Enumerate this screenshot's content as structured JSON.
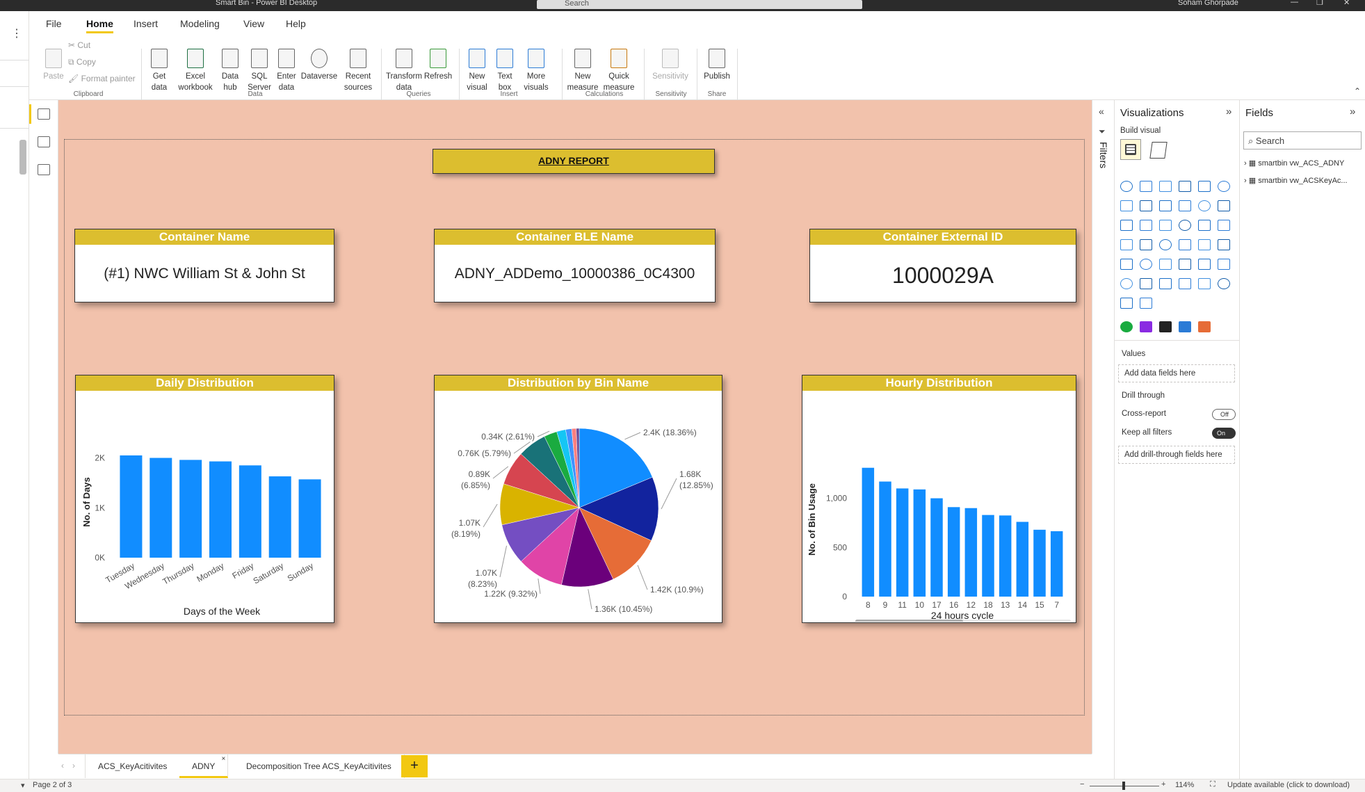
{
  "window": {
    "title": "Smart Bin - Power BI Desktop",
    "search_placeholder": "Search",
    "user": "Soham Ghorpade"
  },
  "ribbon": {
    "tabs": [
      "File",
      "Home",
      "Insert",
      "Modeling",
      "View",
      "Help"
    ],
    "clipboard": {
      "paste": "Paste",
      "cut": "Cut",
      "copy": "Copy",
      "format_painter": "Format painter",
      "group": "Clipboard"
    },
    "data": {
      "get_data": "Get data",
      "excel": "Excel workbook",
      "data_hub": "Data hub",
      "sql": "SQL Server",
      "enter": "Enter data",
      "dataverse": "Dataverse",
      "recent": "Recent sources",
      "group": "Data"
    },
    "queries": {
      "transform": "Transform data",
      "refresh": "Refresh",
      "group": "Queries"
    },
    "insert": {
      "new_visual": "New visual",
      "text_box": "Text box",
      "more_visuals": "More visuals",
      "group": "Insert"
    },
    "calculations": {
      "new_measure": "New measure",
      "quick_measure": "Quick measure",
      "group": "Calculations"
    },
    "sensitivity": {
      "label": "Sensitivity",
      "group": "Sensitivity"
    },
    "share": {
      "publish": "Publish",
      "group": "Share"
    }
  },
  "report": {
    "title": "ADNY REPORT",
    "cards": [
      {
        "header": "Container Name",
        "value": "(#1) NWC William St & John St"
      },
      {
        "header": "Container BLE Name",
        "value": "ADNY_ADDemo_10000386_0C4300"
      },
      {
        "header": "Container External ID",
        "value": "1000029A"
      }
    ]
  },
  "chart_data": [
    {
      "type": "bar",
      "title": "Daily Distribution",
      "xlabel": "Days of the Week",
      "ylabel": "No. of Days",
      "categories": [
        "Tuesday",
        "Wednesday",
        "Thursday",
        "Monday",
        "Friday",
        "Saturday",
        "Sunday"
      ],
      "values": [
        2050,
        2000,
        1960,
        1930,
        1850,
        1630,
        1570
      ],
      "ylim": [
        0,
        2300
      ],
      "yticks": [
        "0K",
        "1K",
        "2K"
      ],
      "color": "#118dff"
    },
    {
      "type": "pie",
      "title": "Distribution by Bin Name",
      "slices": [
        {
          "label": "2.4K (18.36%)",
          "value": 18.36,
          "color": "#118dff"
        },
        {
          "label": "1.68K (12.85%)",
          "value": 12.85,
          "color": "#12239e"
        },
        {
          "label": "1.42K (10.9%)",
          "value": 10.9,
          "color": "#e66c37"
        },
        {
          "label": "1.36K (10.45%)",
          "value": 10.45,
          "color": "#6b007b"
        },
        {
          "label": "1.22K (9.32%)",
          "value": 9.32,
          "color": "#e044a7"
        },
        {
          "label": "1.07K (8.23%)",
          "value": 8.23,
          "color": "#744ec2"
        },
        {
          "label": "1.07K (8.19%)",
          "value": 8.19,
          "color": "#d9b300"
        },
        {
          "label": "0.89K (6.85%)",
          "value": 6.85,
          "color": "#d64550"
        },
        {
          "label": "0.76K (5.79%)",
          "value": 5.79,
          "color": "#197278"
        },
        {
          "label": "0.34K (2.61%)",
          "value": 2.61,
          "color": "#1aab40"
        },
        {
          "label": "",
          "value": 1.8,
          "color": "#15c6f4"
        },
        {
          "label": "",
          "value": 1.2,
          "color": "#4092ff"
        },
        {
          "label": "",
          "value": 0.9,
          "color": "#ff7f7f"
        },
        {
          "label": "",
          "value": 0.6,
          "color": "#6b4c9a"
        }
      ]
    },
    {
      "type": "bar",
      "title": "Hourly Distribution",
      "xlabel": "24 hours cycle",
      "ylabel": "No. of Bin Usage",
      "categories": [
        "8",
        "9",
        "11",
        "10",
        "17",
        "16",
        "12",
        "18",
        "13",
        "14",
        "15",
        "7"
      ],
      "values": [
        1310,
        1170,
        1100,
        1090,
        1000,
        910,
        900,
        830,
        825,
        760,
        680,
        665
      ],
      "ylim": [
        0,
        1400
      ],
      "yticks": [
        "0",
        "500",
        "1,000"
      ],
      "ytickvals": [
        0,
        500,
        1000
      ],
      "color": "#118dff"
    }
  ],
  "filters": {
    "label": "Filters"
  },
  "visualizations": {
    "title": "Visualizations",
    "build_visual": "Build visual",
    "values": "Values",
    "add_data": "Add data fields here",
    "drill_through": "Drill through",
    "cross_report": "Cross-report",
    "cross_state": "Off",
    "keep_filters": "Keep all filters",
    "keep_state": "On",
    "add_drill": "Add drill-through fields here"
  },
  "fields": {
    "title": "Fields",
    "search_placeholder": "Search",
    "tables": [
      "smartbin vw_ACS_ADNY",
      "smartbin vw_ACSKeyAc..."
    ]
  },
  "page_tabs": [
    "ACS_KeyAcitivites",
    "ADNY",
    "Decomposition Tree ACS_KeyAcitivites"
  ],
  "status": {
    "page": "Page 2 of 3",
    "zoom": "114%",
    "update": "Update available (click to download)"
  }
}
